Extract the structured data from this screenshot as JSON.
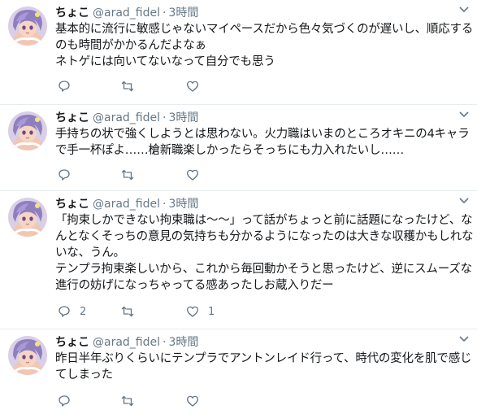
{
  "tweets": [
    {
      "name": "ちょこ",
      "handle": "@arad_fidel",
      "separator": "·",
      "time": "3時間",
      "text": "基本的に流行に敏感じゃないマイペースだから色々気づくのが遅いし、順応するのも時間がかかるんだよなぁ\nネトゲには向いてないなって自分でも思う",
      "reply_count": "",
      "retweet_count": "",
      "like_count": ""
    },
    {
      "name": "ちょこ",
      "handle": "@arad_fidel",
      "separator": "·",
      "time": "3時間",
      "text": "手持ちの状で強くしようとは思わない。火力職はいまのところオキニの4キャラで手一杯ぽよ……槍新職楽しかったらそっちにも力入れたいし……",
      "reply_count": "",
      "retweet_count": "",
      "like_count": ""
    },
    {
      "name": "ちょこ",
      "handle": "@arad_fidel",
      "separator": "·",
      "time": "3時間",
      "text": "「拘束しかできない拘束職は〜〜」って話がちょっと前に話題になったけど、なんとなくそっちの意見の気持ちも分かるようになったのは大きな収穫かもしれないな、うん。\nテンプラ拘束楽しいから、これから毎回動かそうと思ったけど、逆にスムーズな進行の妨げになっちゃってる感あったしお蔵入りだー",
      "reply_count": "2",
      "retweet_count": "",
      "like_count": "1"
    },
    {
      "name": "ちょこ",
      "handle": "@arad_fidel",
      "separator": "·",
      "time": "3時間",
      "text": "昨日半年ぶりくらいにテンプラでアントンレイド行って、時代の変化を肌で感じてしまった",
      "reply_count": "",
      "retweet_count": "",
      "like_count": ""
    }
  ],
  "icons": {
    "reply": "reply-icon",
    "retweet": "retweet-icon",
    "like": "heart-icon",
    "menu": "chevron-down-icon"
  },
  "colors": {
    "text": "#14171a",
    "muted": "#657786",
    "divider": "#e6ecf0"
  }
}
